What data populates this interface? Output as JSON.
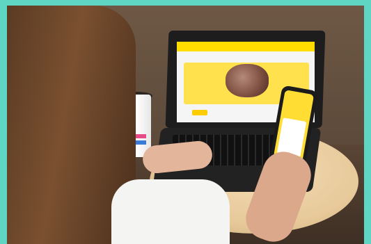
{
  "scene": {
    "description_colors": {
      "border": "#5fd6c4",
      "brand_yellow": "#ffdd00"
    }
  }
}
